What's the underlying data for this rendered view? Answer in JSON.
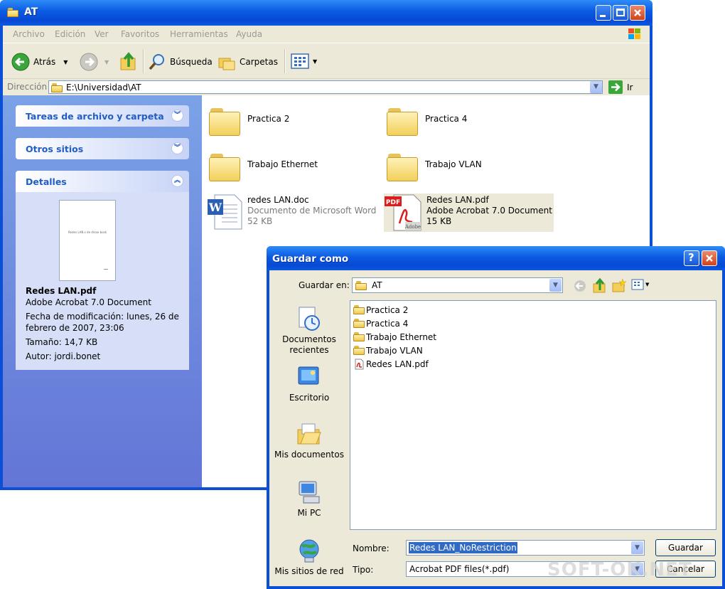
{
  "explorer": {
    "title": "AT",
    "menu": [
      "Archivo",
      "Edición",
      "Ver",
      "Favoritos",
      "Herramientas",
      "Ayuda"
    ],
    "toolbar": {
      "back_label": "Atrás",
      "search_label": "Búsqueda",
      "folders_label": "Carpetas"
    },
    "address": {
      "label": "Dirección",
      "path": "E:\\Universidad\\AT",
      "go_label": "Ir"
    },
    "tasks": {
      "file_folder_tasks": "Tareas de archivo y carpeta",
      "other_places": "Otros sitios",
      "details": "Detalles"
    },
    "details": {
      "thumbnail_text": "Redes LAN.s de drose bosk",
      "name": "Redes LAN.pdf",
      "type": "Adobe Acrobat 7.0 Document",
      "modified": "Fecha de modificación: lunes, 26 de febrero de 2007, 23:06",
      "size": "Tamaño: 14,7 KB",
      "author": "Autor: jordi.bonet"
    },
    "items": [
      {
        "name": "Practica 2",
        "kind": "folder"
      },
      {
        "name": "Practica 4",
        "kind": "folder"
      },
      {
        "name": "Trabajo Ethernet",
        "kind": "folder"
      },
      {
        "name": "Trabajo VLAN",
        "kind": "folder"
      },
      {
        "name": "redes LAN.doc",
        "sub1": "Documento de Microsoft Word",
        "sub2": "52 KB",
        "kind": "word"
      },
      {
        "name": "Redes LAN.pdf",
        "sub1": "Adobe Acrobat 7.0 Document",
        "sub2": "15 KB",
        "kind": "pdf"
      }
    ]
  },
  "dialog": {
    "title": "Guardar como",
    "save_in_label": "Guardar en:",
    "save_in_value": "AT",
    "places": [
      "Documentos recientes",
      "Escritorio",
      "Mis documentos",
      "Mi PC",
      "Mis sitios de red"
    ],
    "files": [
      {
        "name": "Practica 2",
        "kind": "folder"
      },
      {
        "name": "Practica 4",
        "kind": "folder"
      },
      {
        "name": "Trabajo Ethernet",
        "kind": "folder"
      },
      {
        "name": "Trabajo VLAN",
        "kind": "folder"
      },
      {
        "name": "Redes LAN.pdf",
        "kind": "pdf"
      }
    ],
    "name_label": "Nombre:",
    "name_value": "Redes LAN_NoRestriction",
    "type_label": "Tipo:",
    "type_value": "Acrobat PDF files(*.pdf)",
    "save_button": "Guardar",
    "cancel_button": "Cancelar"
  },
  "watermark": "SOFT-OK.NET",
  "colors": {
    "xp_blue": "#0a4fd6",
    "task_pane": "#6f8fdf",
    "selection": "#316ac5",
    "chrome": "#ece9d8"
  }
}
